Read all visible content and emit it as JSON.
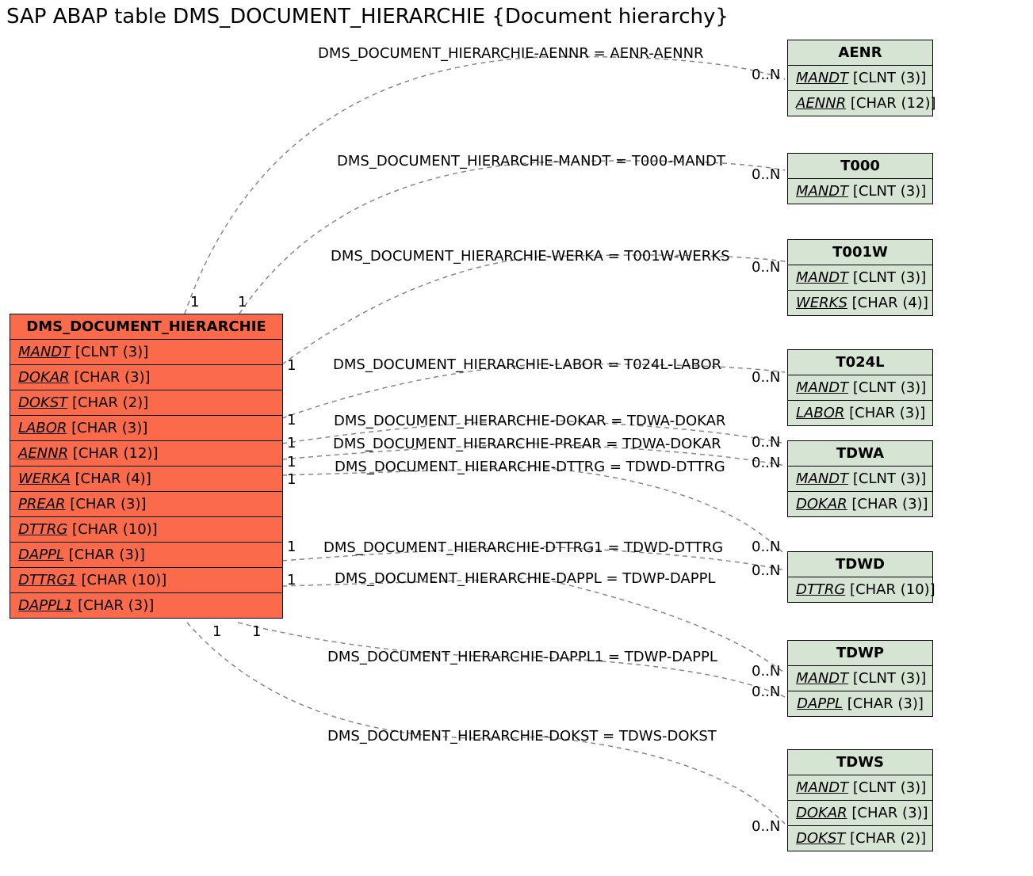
{
  "title": "SAP ABAP table DMS_DOCUMENT_HIERARCHIE {Document hierarchy}",
  "main": {
    "name": "DMS_DOCUMENT_HIERARCHIE",
    "fields": [
      {
        "n": "MANDT",
        "t": "[CLNT (3)]"
      },
      {
        "n": "DOKAR",
        "t": "[CHAR (3)]"
      },
      {
        "n": "DOKST",
        "t": "[CHAR (2)]"
      },
      {
        "n": "LABOR",
        "t": "[CHAR (3)]"
      },
      {
        "n": "AENNR",
        "t": "[CHAR (12)]"
      },
      {
        "n": "WERKA",
        "t": "[CHAR (4)]"
      },
      {
        "n": "PREAR",
        "t": "[CHAR (3)]"
      },
      {
        "n": "DTTRG",
        "t": "[CHAR (10)]"
      },
      {
        "n": "DAPPL",
        "t": "[CHAR (3)]"
      },
      {
        "n": "DTTRG1",
        "t": "[CHAR (10)]"
      },
      {
        "n": "DAPPL1",
        "t": "[CHAR (3)]"
      }
    ]
  },
  "refs": [
    {
      "name": "AENR",
      "fields": [
        {
          "n": "MANDT",
          "t": "[CLNT (3)]"
        },
        {
          "n": "AENNR",
          "t": "[CHAR (12)]"
        }
      ]
    },
    {
      "name": "T000",
      "fields": [
        {
          "n": "MANDT",
          "t": "[CLNT (3)]"
        }
      ]
    },
    {
      "name": "T001W",
      "fields": [
        {
          "n": "MANDT",
          "t": "[CLNT (3)]"
        },
        {
          "n": "WERKS",
          "t": "[CHAR (4)]"
        }
      ]
    },
    {
      "name": "T024L",
      "fields": [
        {
          "n": "MANDT",
          "t": "[CLNT (3)]"
        },
        {
          "n": "LABOR",
          "t": "[CHAR (3)]"
        }
      ]
    },
    {
      "name": "TDWA",
      "fields": [
        {
          "n": "MANDT",
          "t": "[CLNT (3)]"
        },
        {
          "n": "DOKAR",
          "t": "[CHAR (3)]"
        }
      ]
    },
    {
      "name": "TDWD",
      "fields": [
        {
          "n": "DTTRG",
          "t": "[CHAR (10)]"
        }
      ]
    },
    {
      "name": "TDWP",
      "fields": [
        {
          "n": "MANDT",
          "t": "[CLNT (3)]"
        },
        {
          "n": "DAPPL",
          "t": "[CHAR (3)]"
        }
      ]
    },
    {
      "name": "TDWS",
      "fields": [
        {
          "n": "MANDT",
          "t": "[CLNT (3)]"
        },
        {
          "n": "DOKAR",
          "t": "[CHAR (3)]"
        },
        {
          "n": "DOKST",
          "t": "[CHAR (2)]"
        }
      ]
    }
  ],
  "relations": [
    "DMS_DOCUMENT_HIERARCHIE-AENNR = AENR-AENNR",
    "DMS_DOCUMENT_HIERARCHIE-MANDT = T000-MANDT",
    "DMS_DOCUMENT_HIERARCHIE-WERKA = T001W-WERKS",
    "DMS_DOCUMENT_HIERARCHIE-LABOR = T024L-LABOR",
    "DMS_DOCUMENT_HIERARCHIE-DOKAR = TDWA-DOKAR",
    "DMS_DOCUMENT_HIERARCHIE-PREAR = TDWA-DOKAR",
    "DMS_DOCUMENT_HIERARCHIE-DTTRG = TDWD-DTTRG",
    "DMS_DOCUMENT_HIERARCHIE-DTTRG1 = TDWD-DTTRG",
    "DMS_DOCUMENT_HIERARCHIE-DAPPL = TDWP-DAPPL",
    "DMS_DOCUMENT_HIERARCHIE-DAPPL1 = TDWP-DAPPL",
    "DMS_DOCUMENT_HIERARCHIE-DOKST = TDWS-DOKST"
  ],
  "cards": {
    "one": "1",
    "many": "0..N"
  }
}
